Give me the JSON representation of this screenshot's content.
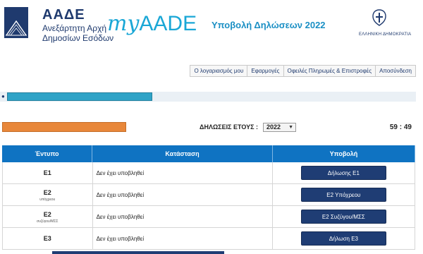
{
  "header": {
    "org_short": "ΑΑΔΕ",
    "org_line1": "Ανεξάρτητη Αρχή",
    "org_line2": "Δημοσίων Εσόδων",
    "brand_my": "my",
    "brand_aade": "AADE",
    "heading": "Υποβολή Δηλώσεων 2022",
    "gov_label": "ΕΛΛΗΝΙΚΗ ΔΗΜΟΚΡΑΤΙΑ",
    "icons": {
      "logo": "aade-logo-icon",
      "emblem": "greek-emblem-icon"
    }
  },
  "nav": {
    "items": [
      {
        "label": "Ο λογαριασμός μου"
      },
      {
        "label": "Εφαρμογές"
      },
      {
        "label": "Οφειλές Πληρωμές & Επιστροφές"
      },
      {
        "label": "Αποσύνδεση"
      }
    ]
  },
  "userbar": {
    "icon": "user-icon",
    "redacted_color": "#2fa3c7"
  },
  "year_row": {
    "redacted_color": "#e8873a",
    "label": "ΔΗΛΩΣΕΙΣ ΕΤΟΥΣ :",
    "selected_year": "2022",
    "timer": "59 : 49"
  },
  "table": {
    "headers": [
      "Έντυπο",
      "Κατάσταση",
      "Υποβολή"
    ],
    "rows": [
      {
        "form": "Ε1",
        "sub": "",
        "status": "Δεν έχει υποβληθεί",
        "action": "Δήλωσης Ε1"
      },
      {
        "form": "Ε2",
        "sub": "υπόχρεου",
        "status": "Δεν έχει υποβληθεί",
        "action": "Ε2 Υπόχρεου"
      },
      {
        "form": "Ε2",
        "sub": "συζύγου/ΜΣΣ",
        "status": "Δεν έχει υποβληθεί",
        "action": "Ε2 Συζύγου/ΜΣΣ"
      },
      {
        "form": "Ε3",
        "sub": "",
        "status": "Δεν έχει υποβληθεί",
        "action": "Δήλωση Ε3"
      }
    ]
  },
  "colors": {
    "header_blue": "#0f73c2",
    "button_navy": "#1f3d74",
    "brand_cyan": "#1aa7d6"
  }
}
